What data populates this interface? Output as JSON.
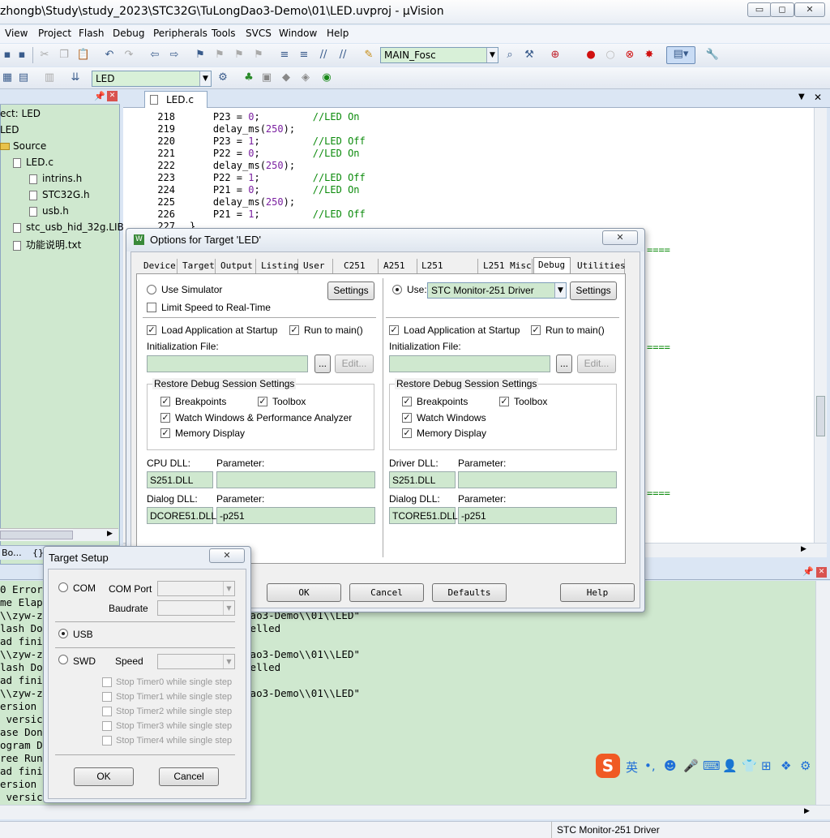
{
  "window": {
    "title": "zhongb\\Study\\study_2023\\STC32G\\TuLongDao3-Demo\\01\\LED.uvproj - µVision"
  },
  "menu": [
    "View",
    "Project",
    "Flash",
    "Debug",
    "Peripherals",
    "Tools",
    "SVCS",
    "Window",
    "Help"
  ],
  "toolbar": {
    "main_combo": "MAIN_Fosc",
    "target_combo": "LED"
  },
  "project": {
    "items": [
      "ect: LED",
      "LED",
      "Source",
      "LED.c",
      "intrins.h",
      "STC32G.h",
      "usb.h",
      "stc_usb_hid_32g.LIB",
      "功能说明.txt"
    ],
    "bottom_tabs": [
      "Bo...",
      "{}"
    ]
  },
  "editor": {
    "tab": "LED.c",
    "lines": [
      {
        "n": "218",
        "a": "    P23 = ",
        "v": "0",
        "b": ";         ",
        "c": "//LED On"
      },
      {
        "n": "219",
        "a": "    delay_ms(",
        "v": "250",
        "b": ");",
        "c": ""
      },
      {
        "n": "220",
        "a": "    P23 = ",
        "v": "1",
        "b": ";         ",
        "c": "//LED Off"
      },
      {
        "n": "221",
        "a": "    P22 = ",
        "v": "0",
        "b": ";         ",
        "c": "//LED On"
      },
      {
        "n": "222",
        "a": "    delay_ms(",
        "v": "250",
        "b": ");",
        "c": ""
      },
      {
        "n": "223",
        "a": "    P22 = ",
        "v": "1",
        "b": ";         ",
        "c": "//LED Off"
      },
      {
        "n": "224",
        "a": "    P21 = ",
        "v": "0",
        "b": ";         ",
        "c": "//LED On"
      },
      {
        "n": "225",
        "a": "    delay_ms(",
        "v": "250",
        "b": ");",
        "c": ""
      },
      {
        "n": "226",
        "a": "    P21 = ",
        "v": "1",
        "b": ";         ",
        "c": "//LED Off"
      },
      {
        "n": "227",
        "a": "}",
        "v": "",
        "b": "",
        "c": ""
      }
    ],
    "eq_marks": [
      "====",
      "====",
      "===="
    ]
  },
  "output": {
    "lines": [
      "0 Error",
      "me Elap",
      "\\\\zyw-z                         \\\\TuLongDao3-Demo\\\\01\\\\LED\"",
      "lash Do                         been cancelled",
      "ad fini",
      "\\\\zyw-z                         \\\\TuLongDao3-Demo\\\\01\\\\LED\"",
      "lash Do                         been cancelled",
      "ad fini",
      "\\\\zyw-z                         \\\\TuLongDao3-Demo\\\\01\\\\LED\"",
      "ersion",
      " versic",
      "ase Don",
      "ogram D",
      "ree Run",
      "ad fini",
      "ersion",
      " versic"
    ]
  },
  "status": {
    "driver": "STC Monitor-251 Driver"
  },
  "options": {
    "title": "Options for Target 'LED'",
    "tabs": [
      "Device",
      "Target",
      "Output",
      "Listing",
      "User",
      "C251",
      "A251",
      "L251 Locate",
      "L251 Misc",
      "Debug",
      "Utilities"
    ],
    "left": {
      "use_simulator": "Use Simulator",
      "settings": "Settings",
      "limit_speed": "Limit Speed to Real-Time",
      "load_app": "Load Application at Startup",
      "run_to_main": "Run to main()",
      "init_file": "Initialization File:",
      "browse": "...",
      "edit": "Edit...",
      "restore": "Restore Debug Session Settings",
      "breakpoints": "Breakpoints",
      "toolbox": "Toolbox",
      "watch": "Watch Windows & Performance Analyzer",
      "memory": "Memory Display",
      "cpu_dll_label": "CPU DLL:",
      "param_label": "Parameter:",
      "cpu_dll": "S251.DLL",
      "cpu_param": "",
      "dialog_dll_label": "Dialog DLL:",
      "dialog_dll": "DCORE51.DLL",
      "dialog_param": "-p251"
    },
    "right": {
      "use": "Use:",
      "driver": "STC Monitor-251 Driver",
      "settings": "Settings",
      "load_app": "Load Application at Startup",
      "run_to_main": "Run to main()",
      "init_file": "Initialization File:",
      "browse": "...",
      "edit": "Edit...",
      "restore": "Restore Debug Session Settings",
      "breakpoints": "Breakpoints",
      "toolbox": "Toolbox",
      "watch": "Watch Windows",
      "memory": "Memory Display",
      "driver_dll_label": "Driver DLL:",
      "param_label": "Parameter:",
      "driver_dll": "S251.DLL",
      "driver_param": "",
      "dialog_dll_label": "Dialog DLL:",
      "dialog_dll": "TCORE51.DLL",
      "dialog_param": "-p251"
    },
    "buttons": {
      "ok": "OK",
      "cancel": "Cancel",
      "defaults": "Defaults",
      "help": "Help"
    }
  },
  "target_setup": {
    "title": "Target Setup",
    "com": "COM",
    "com_port": "COM Port",
    "baudrate": "Baudrate",
    "usb": "USB",
    "swd": "SWD",
    "speed": "Speed",
    "timers": [
      "Stop Timer0 while single step",
      "Stop Timer1 while single step",
      "Stop Timer2 while single step",
      "Stop Timer3 while single step",
      "Stop Timer4 while single step"
    ],
    "ok": "OK",
    "cancel": "Cancel"
  },
  "ime": {
    "lang": "英"
  }
}
